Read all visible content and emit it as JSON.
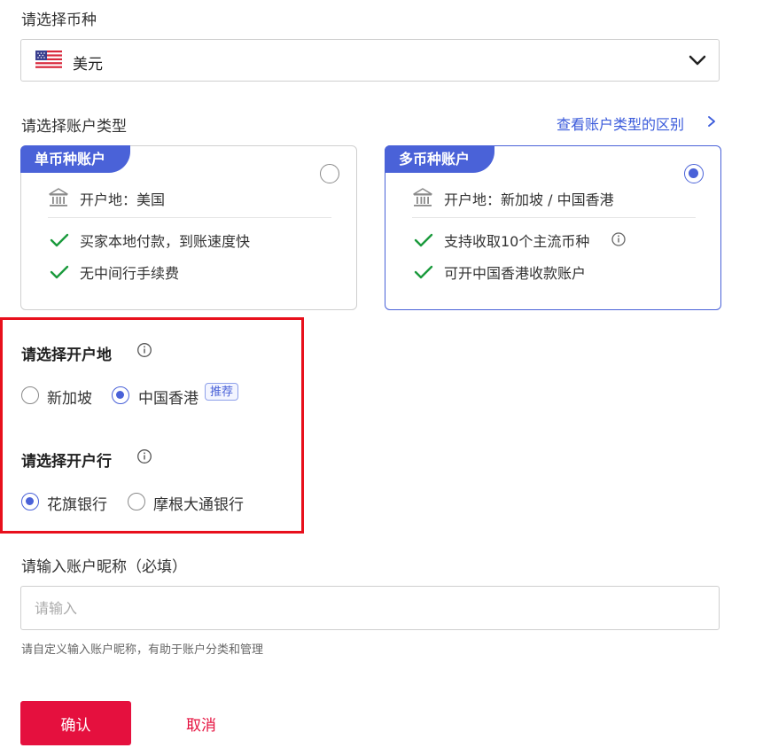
{
  "currency": {
    "label": "请选择币种",
    "selected": "美元",
    "flag_icon": "us-flag-icon"
  },
  "account_type": {
    "label": "请选择账户类型",
    "compare_link": "查看账户类型的区别",
    "cards": [
      {
        "tag": "单币种账户",
        "location": "开户地：美国",
        "features": [
          "买家本地付款，到账速度快",
          "无中间行手续费"
        ],
        "selected": false
      },
      {
        "tag": "多币种账户",
        "location": "开户地：新加坡 / 中国香港",
        "features": [
          "支持收取10个主流币种",
          "可开中国香港收款账户"
        ],
        "selected": true
      }
    ]
  },
  "open_location": {
    "label": "请选择开户地",
    "options": [
      {
        "label": "新加坡",
        "selected": false
      },
      {
        "label": "中国香港",
        "selected": true,
        "badge": "推荐"
      }
    ]
  },
  "open_bank": {
    "label": "请选择开户行",
    "options": [
      {
        "label": "花旗银行",
        "selected": true
      },
      {
        "label": "摩根大通银行",
        "selected": false
      }
    ]
  },
  "nickname": {
    "label": "请输入账户昵称（必填）",
    "placeholder": "请输入",
    "value": "",
    "hint": "请自定义输入账户昵称，有助于账户分类和管理"
  },
  "actions": {
    "confirm": "确认",
    "cancel": "取消"
  },
  "colors": {
    "accent": "#4a62d8",
    "primary_button": "#e5103e",
    "highlight_border": "#e8101c",
    "check": "#1a9a3c"
  }
}
